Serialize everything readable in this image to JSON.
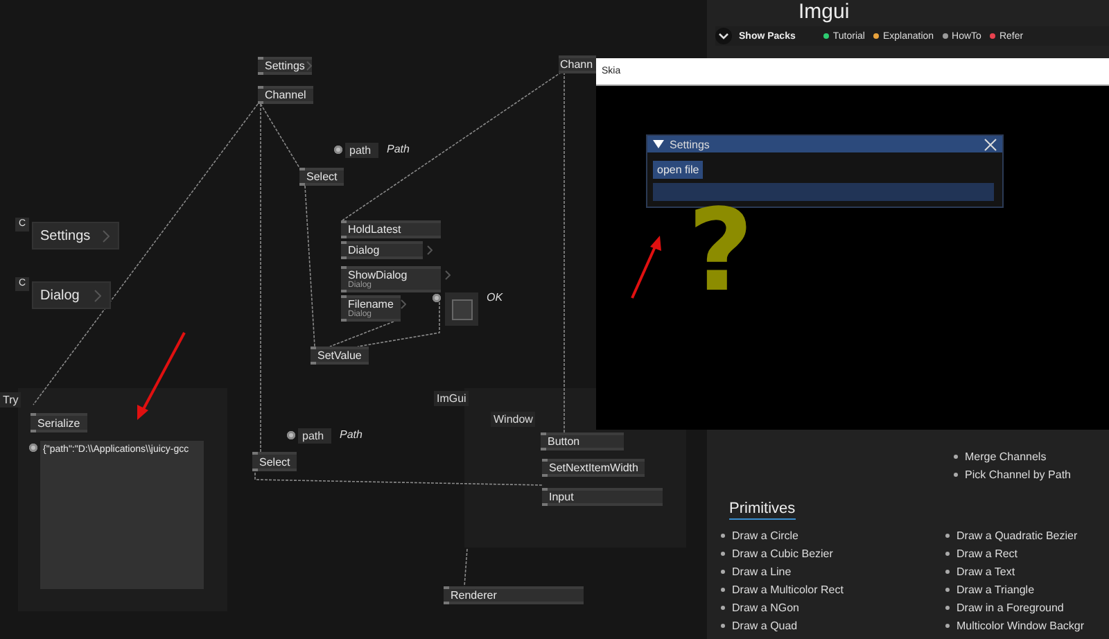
{
  "canvas": {
    "nodes": [
      {
        "label": "Settings",
        "more": true
      },
      {
        "label": "Channel",
        "more": false
      },
      {
        "label": "Select",
        "more": false
      },
      {
        "label": "Chann",
        "more": false
      },
      {
        "label": "HoldLatest",
        "more": false
      },
      {
        "label": "Dialog",
        "more": true
      },
      {
        "label": "ShowDialog",
        "sublabel": "Dialog",
        "more": true
      },
      {
        "label": "Filename",
        "sublabel": "Dialog",
        "more": true
      },
      {
        "label": "SetValue",
        "more": false
      },
      {
        "label": "Serialize",
        "more": false
      },
      {
        "label": "Select",
        "more": false
      },
      {
        "label": "Button",
        "more": false
      },
      {
        "label": "SetNextItemWidth",
        "more": false
      },
      {
        "label": "Input",
        "more": false
      },
      {
        "label": "Renderer",
        "more": false
      }
    ],
    "pins": [
      {
        "value": "path",
        "hint": "Path"
      },
      {
        "value": "path",
        "hint": "Path"
      }
    ],
    "toggle": {
      "label": "OK",
      "checked": false
    },
    "create_nodes": [
      {
        "badge": "C",
        "label": "Settings"
      },
      {
        "badge": "C",
        "label": "Dialog"
      }
    ],
    "groups": [
      {
        "label": "Try"
      },
      {
        "label": "ImGui"
      },
      {
        "label": "Window"
      }
    ],
    "serialized_text": "{\"path\":\"D:\\\\Applications\\\\juicy-gcc"
  },
  "docs": {
    "heading": "Imgui",
    "show_packs": "Show Packs",
    "legend": [
      {
        "label": "Tutorial",
        "color": "#2ecc71"
      },
      {
        "label": "Explanation",
        "color": "#e8a23c"
      },
      {
        "label": "HowTo",
        "color": "#9a9a9a"
      },
      {
        "label": "Refer",
        "color": "#e8424f"
      }
    ],
    "upper_items": [
      {
        "label": "Merge Channels"
      },
      {
        "label": "Pick Channel by Path"
      }
    ],
    "section": "Primitives",
    "primitives_left": [
      "Draw a Circle",
      "Draw a Cubic Bezier",
      "Draw a Line",
      "Draw a Multicolor Rect",
      "Draw a NGon",
      "Draw a Quad"
    ],
    "primitives_right": [
      "Draw a Quadratic Bezier",
      "Draw a Rect",
      "Draw a Text",
      "Draw a Triangle",
      "Draw in a Foreground",
      "Multicolor Window Backgr"
    ]
  },
  "skia": {
    "title": "Skia",
    "settings_window": {
      "title": "Settings",
      "expanded": true,
      "button": "open file"
    },
    "glyph": "?"
  }
}
